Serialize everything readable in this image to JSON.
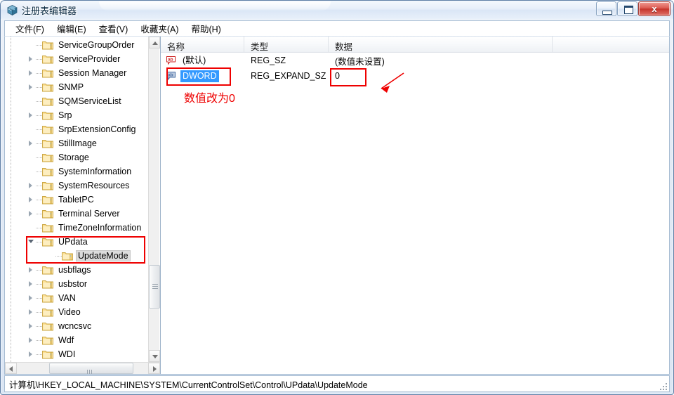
{
  "window": {
    "title": "注册表编辑器",
    "app_icon": "registry-editor-icon",
    "minimize_label": "",
    "maximize_label": "",
    "close_label": "x"
  },
  "menubar": {
    "items": [
      {
        "label": "文件(F)",
        "name": "menu-file"
      },
      {
        "label": "编辑(E)",
        "name": "menu-edit"
      },
      {
        "label": "查看(V)",
        "name": "menu-view"
      },
      {
        "label": "收藏夹(A)",
        "name": "menu-favorites"
      },
      {
        "label": "帮助(H)",
        "name": "menu-help"
      }
    ]
  },
  "tree": {
    "items": [
      {
        "label": "ServiceGroupOrder",
        "depth": 1,
        "expander": "none",
        "selected": false
      },
      {
        "label": "ServiceProvider",
        "depth": 1,
        "expander": "collapsed",
        "selected": false
      },
      {
        "label": "Session Manager",
        "depth": 1,
        "expander": "collapsed",
        "selected": false
      },
      {
        "label": "SNMP",
        "depth": 1,
        "expander": "collapsed",
        "selected": false
      },
      {
        "label": "SQMServiceList",
        "depth": 1,
        "expander": "none",
        "selected": false
      },
      {
        "label": "Srp",
        "depth": 1,
        "expander": "collapsed",
        "selected": false
      },
      {
        "label": "SrpExtensionConfig",
        "depth": 1,
        "expander": "none",
        "selected": false
      },
      {
        "label": "StillImage",
        "depth": 1,
        "expander": "collapsed",
        "selected": false
      },
      {
        "label": "Storage",
        "depth": 1,
        "expander": "none",
        "selected": false
      },
      {
        "label": "SystemInformation",
        "depth": 1,
        "expander": "none",
        "selected": false
      },
      {
        "label": "SystemResources",
        "depth": 1,
        "expander": "collapsed",
        "selected": false
      },
      {
        "label": "TabletPC",
        "depth": 1,
        "expander": "collapsed",
        "selected": false
      },
      {
        "label": "Terminal Server",
        "depth": 1,
        "expander": "collapsed",
        "selected": false
      },
      {
        "label": "TimeZoneInformation",
        "depth": 1,
        "expander": "none",
        "selected": false
      },
      {
        "label": "UPdata",
        "depth": 1,
        "expander": "expanded",
        "selected": false
      },
      {
        "label": "UpdateMode",
        "depth": 2,
        "expander": "none",
        "selected": true
      },
      {
        "label": "usbflags",
        "depth": 1,
        "expander": "collapsed",
        "selected": false
      },
      {
        "label": "usbstor",
        "depth": 1,
        "expander": "collapsed",
        "selected": false
      },
      {
        "label": "VAN",
        "depth": 1,
        "expander": "collapsed",
        "selected": false
      },
      {
        "label": "Video",
        "depth": 1,
        "expander": "collapsed",
        "selected": false
      },
      {
        "label": "wcncsvc",
        "depth": 1,
        "expander": "collapsed",
        "selected": false
      },
      {
        "label": "Wdf",
        "depth": 1,
        "expander": "collapsed",
        "selected": false
      },
      {
        "label": "WDI",
        "depth": 1,
        "expander": "collapsed",
        "selected": false
      }
    ]
  },
  "list": {
    "columns": [
      "名称",
      "类型",
      "数据",
      ""
    ],
    "rows": [
      {
        "name": "(默认)",
        "type": "REG_SZ",
        "data": "(数值未设置)",
        "icon": "string-value-icon",
        "selected": false
      },
      {
        "name": "DWORD",
        "type": "REG_EXPAND_SZ",
        "data": "0",
        "icon": "string-value-icon",
        "selected": true
      }
    ]
  },
  "annotations": {
    "color": "#ee0000",
    "value_note": "数值改为0",
    "tree_box_target": "UPdata-UpdateMode",
    "name_box_target": "DWORD",
    "data_box_target": "0"
  },
  "statusbar": {
    "path": "计算机\\HKEY_LOCAL_MACHINE\\SYSTEM\\CurrentControlSet\\Control\\UPdata\\UpdateMode"
  }
}
